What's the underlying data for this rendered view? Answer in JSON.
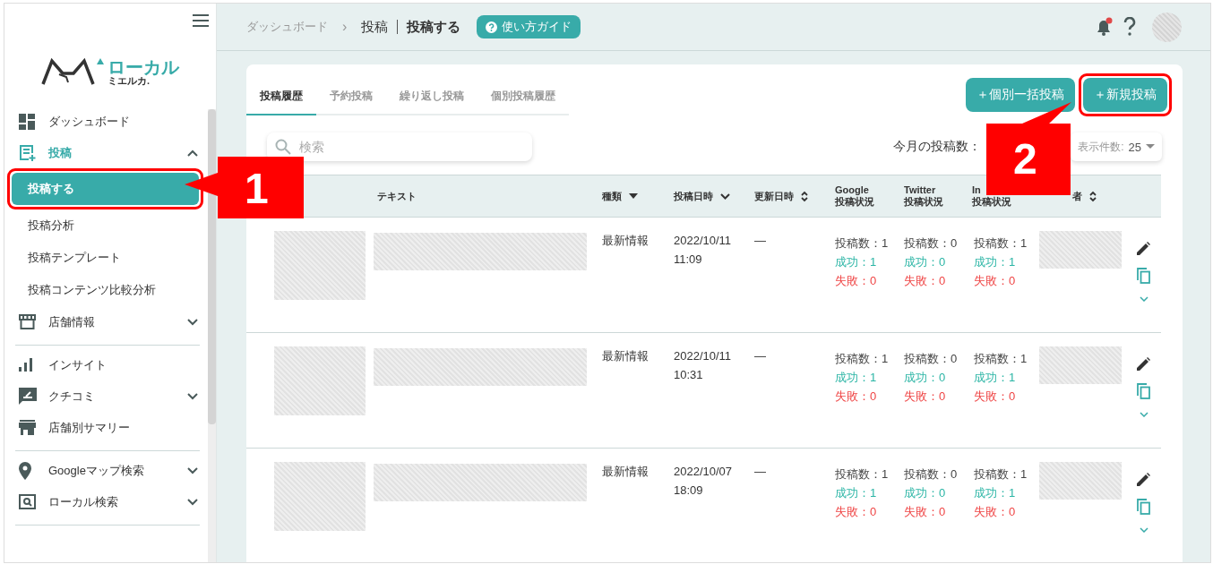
{
  "sidebar": {
    "logo": {
      "main": "ローカル",
      "sub": "ミエルカ."
    },
    "groups": [
      {
        "items": [
          {
            "label": "ダッシュボード"
          },
          {
            "label": "投稿",
            "expanded": true,
            "children": [
              {
                "label": "投稿する",
                "selected": true
              },
              {
                "label": "投稿分析",
                "selected": false
              },
              {
                "label": "投稿テンプレート",
                "selected": false
              },
              {
                "label": "投稿コンテンツ比較分析",
                "selected": false
              }
            ]
          },
          {
            "label": "店舗情報",
            "expanded": false
          }
        ]
      },
      {
        "items": [
          {
            "label": "インサイト"
          },
          {
            "label": "クチコミ",
            "expanded": false
          },
          {
            "label": "店舗別サマリー"
          }
        ]
      },
      {
        "items": [
          {
            "label": "Googleマップ検索",
            "expanded": false
          },
          {
            "label": "ローカル検索",
            "expanded": false
          }
        ]
      }
    ]
  },
  "header": {
    "breadcrumb": "ダッシュボード",
    "separator": "›",
    "section": "投稿",
    "page": "投稿する",
    "guide_button": "使い方ガイド",
    "notifications_unread": true
  },
  "tabs": [
    {
      "label": "投稿履歴",
      "selected": true
    },
    {
      "label": "予約投稿",
      "selected": false
    },
    {
      "label": "繰り返し投稿",
      "selected": false
    },
    {
      "label": "個別投稿履歴",
      "selected": false
    }
  ],
  "buttons": [
    {
      "label": "＋個別一括投稿"
    },
    {
      "label": "＋新規投稿"
    }
  ],
  "search": {
    "placeholder": "検索"
  },
  "monthly_posts_label": "今月の投稿数：",
  "per_page": {
    "label": "表示件数:",
    "value": "25"
  },
  "table": {
    "columns": [
      {},
      {
        "label": "テキスト"
      },
      {
        "label": "種類",
        "kind": "filter"
      },
      {
        "label": "投稿日時",
        "kind": "sort_desc"
      },
      {
        "label": "更新日時",
        "kind": "sort_both"
      },
      {
        "label": "Google",
        "sub": "投稿状況"
      },
      {
        "label": "Twitter",
        "sub": "投稿状況"
      },
      {
        "label": "In",
        "sub": "投稿状況"
      },
      {
        "label": "者",
        "kind": "sort_both"
      },
      {}
    ],
    "rows": [
      {
        "type": "最新情報",
        "posted_date": "2022/10/11",
        "posted_time": "11:09",
        "updated": "—",
        "status": [
          {
            "count": "投稿数：1",
            "success": "成功：1",
            "fail": "失敗：0"
          },
          {
            "count": "投稿数：0",
            "success": "成功：0",
            "fail": "失敗：0"
          },
          {
            "count": "投稿数：1",
            "success": "成功：1",
            "fail": "失敗：0"
          }
        ]
      },
      {
        "type": "最新情報",
        "posted_date": "2022/10/11",
        "posted_time": "10:31",
        "updated": "—",
        "status": [
          {
            "count": "投稿数：1",
            "success": "成功：1",
            "fail": "失敗：0"
          },
          {
            "count": "投稿数：0",
            "success": "成功：0",
            "fail": "失敗：0"
          },
          {
            "count": "投稿数：1",
            "success": "成功：1",
            "fail": "失敗：0"
          }
        ]
      },
      {
        "type": "最新情報",
        "posted_date": "2022/10/07",
        "posted_time": "18:09",
        "updated": "—",
        "status": [
          {
            "count": "投稿数：1",
            "success": "成功：1",
            "fail": "失敗：0"
          },
          {
            "count": "投稿数：0",
            "success": "成功：0",
            "fail": "失敗：0"
          },
          {
            "count": "投稿数：1",
            "success": "成功：1",
            "fail": "失敗：0"
          }
        ]
      }
    ]
  },
  "annotations": [
    {
      "label": "1"
    },
    {
      "label": "2"
    }
  ]
}
